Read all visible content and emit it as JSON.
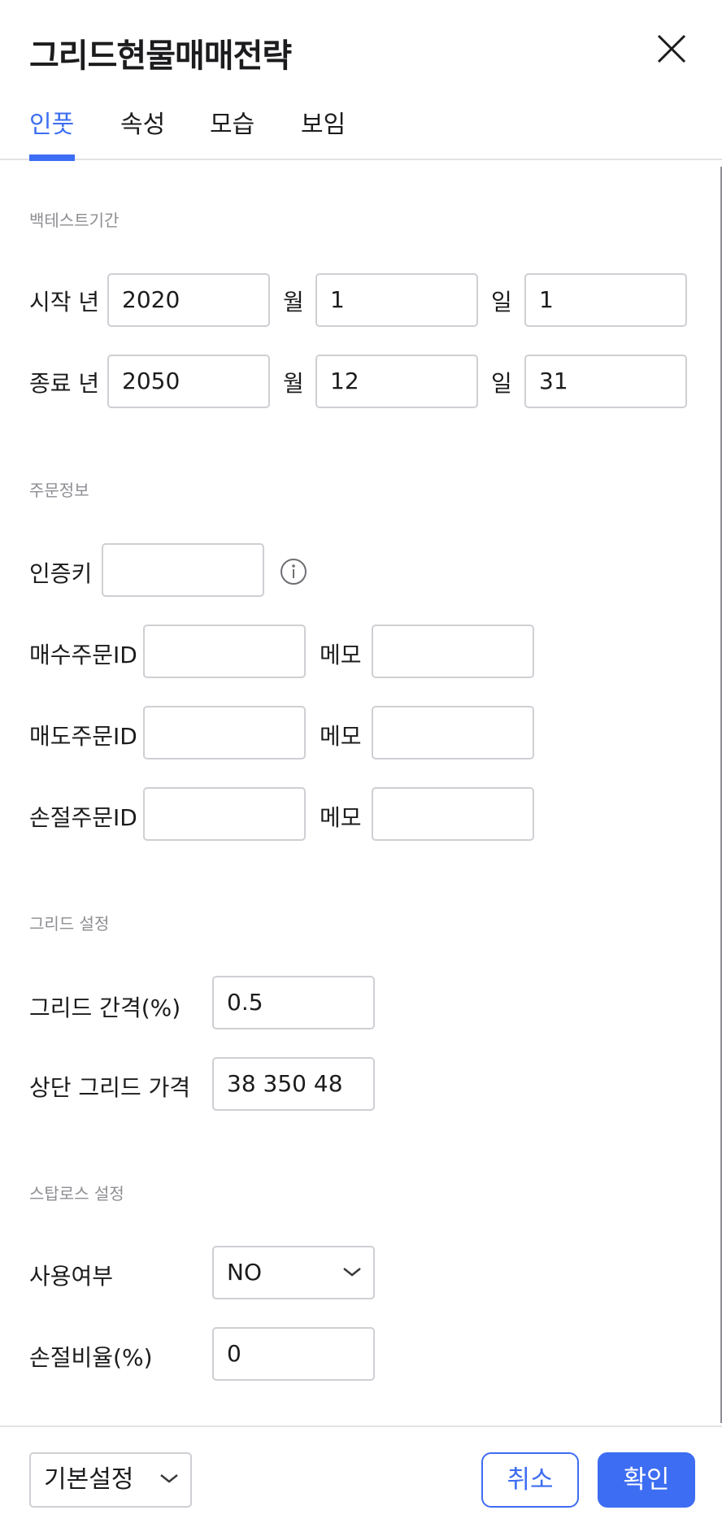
{
  "header": {
    "title": "그리드현물매매전략",
    "close_icon": "close-icon"
  },
  "tabs": [
    {
      "label": "인풋",
      "active": true
    },
    {
      "label": "속성",
      "active": false
    },
    {
      "label": "모습",
      "active": false
    },
    {
      "label": "보임",
      "active": false
    }
  ],
  "backtest": {
    "section_title": "백테스트기간",
    "start_label": "시작 년",
    "end_label": "종료 년",
    "month_label": "월",
    "day_label": "일",
    "start": {
      "year": "2020",
      "month": "1",
      "day": "1"
    },
    "end": {
      "year": "2050",
      "month": "12",
      "day": "31"
    }
  },
  "order": {
    "section_title": "주문정보",
    "auth_key_label": "인증키",
    "auth_key_value": "",
    "info_icon": "info-icon",
    "memo_label": "메모",
    "rows": [
      {
        "label": "매수주문ID",
        "id_value": "",
        "memo_value": ""
      },
      {
        "label": "매도주문ID",
        "id_value": "",
        "memo_value": ""
      },
      {
        "label": "손절주문ID",
        "id_value": "",
        "memo_value": ""
      }
    ]
  },
  "grid": {
    "section_title": "그리드 설정",
    "interval_label": "그리드 간격(%)",
    "interval_value": "0.5",
    "upper_label": "상단 그리드 가격",
    "upper_value": "38 350 48"
  },
  "stoploss": {
    "section_title": "스탑로스 설정",
    "use_label": "사용여부",
    "use_value": "NO",
    "ratio_label": "손절비율(%)",
    "ratio_value": "0"
  },
  "footer": {
    "preset_value": "기본설정",
    "cancel_label": "취소",
    "ok_label": "확인"
  },
  "colors": {
    "accent": "#3d6df2",
    "text": "#1c1c1e",
    "muted": "#8e8e93",
    "border": "#cfcfd4"
  }
}
